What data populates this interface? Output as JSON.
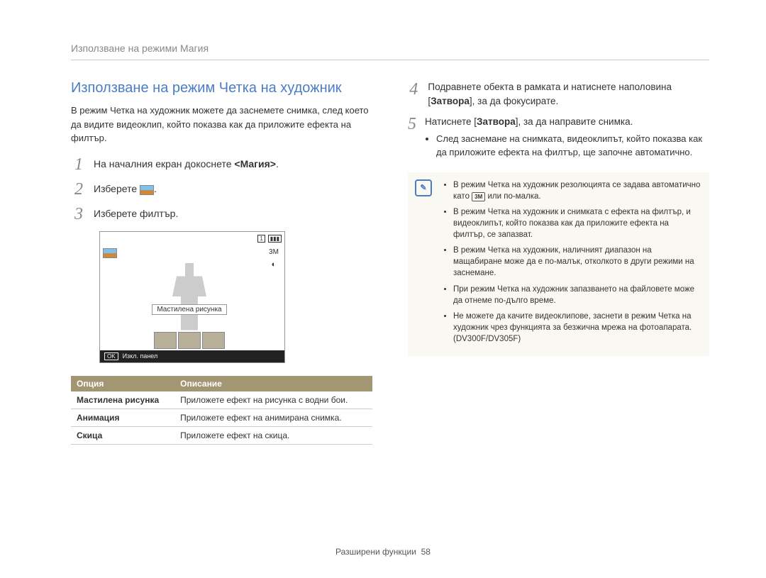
{
  "header": "Използване на режими Магия",
  "left": {
    "title": "Използване на режим Четка на художник",
    "intro": "В режим Четка на художник можете да заснемете снимка, след което да видите видеоклип, който показва как да приложите ефекта на филтър.",
    "steps": {
      "s1_a": "На началния екран докоснете ",
      "s1_b": "<Магия>",
      "s1_c": ".",
      "s2_a": "Изберете ",
      "s2_b": ".",
      "s3": "Изберете филтър."
    },
    "screenshot": {
      "label": "Мастилена рисунка",
      "ok": "OK",
      "footer": "Изкл. панел"
    },
    "table": {
      "head_option": "Опция",
      "head_desc": "Описание",
      "rows": [
        {
          "name": "Мастилена рисунка",
          "desc": "Приложете ефект на рисунка с водни бои."
        },
        {
          "name": "Анимация",
          "desc": "Приложете ефект на анимирана снимка."
        },
        {
          "name": "Скица",
          "desc": "Приложете ефект на скица."
        }
      ]
    }
  },
  "right": {
    "step4_a": "Подравнете обекта в рамката и натиснете наполовина [",
    "step4_b": "Затвора",
    "step4_c": "], за да фокусирате.",
    "step5_a": "Натиснете [",
    "step5_b": "Затвора",
    "step5_c": "], за да направите снимка.",
    "bullet5": "След заснемане на снимката, видеоклипът, който показва как да приложите ефекта на филтър, ще започне автоматично.",
    "note": {
      "n1_a": "В режим Четка на художник резолюцията се задава автоматично като ",
      "n1_badge": "3M",
      "n1_b": " или по-малка.",
      "n2": "В режим Четка на художник и снимката с ефекта на филтър, и видеоклипът, който показва как да приложите ефекта на филтър, се запазват.",
      "n3": "В режим Четка на художник, наличният диапазон на мащабиране може да е по-малък, отколкото в други режими на заснемане.",
      "n4": "При режим Четка на художник запазването на файловете може да отнеме по-дълго време.",
      "n5": "Не можете да качите видеоклипове, заснети в режим Четка на художник чрез функцията за безжична мрежа на фотоапарата. (DV300F/DV305F)"
    }
  },
  "footer": {
    "section": "Разширени функции",
    "page": "58"
  }
}
